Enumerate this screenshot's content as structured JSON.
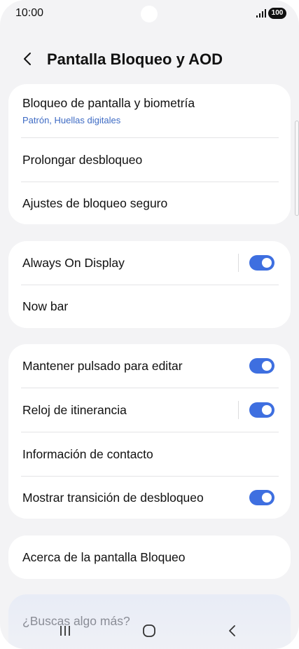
{
  "status_bar": {
    "time": "10:00",
    "battery": "100"
  },
  "header": {
    "title": "Pantalla Bloqueo y AOD"
  },
  "group1": {
    "lock_screen_label": "Bloqueo de pantalla y biometría",
    "lock_screen_sub": "Patrón, Huellas digitales",
    "extend_unlock_label": "Prolongar desbloqueo",
    "secure_lock_label": "Ajustes de bloqueo seguro"
  },
  "group2": {
    "aod_label": "Always On Display",
    "aod_enabled": true,
    "now_bar_label": "Now bar"
  },
  "group3": {
    "hold_edit_label": "Mantener pulsado para editar",
    "hold_edit_enabled": true,
    "roaming_clock_label": "Reloj de itinerancia",
    "roaming_clock_enabled": true,
    "contact_info_label": "Información de contacto",
    "unlock_transition_label": "Mostrar transición de desbloqueo",
    "unlock_transition_enabled": true
  },
  "group4": {
    "about_label": "Acerca de la pantalla Bloqueo"
  },
  "more": {
    "label": "¿Buscas algo más?"
  },
  "colors": {
    "accent": "#3e6fe0",
    "subtext": "#3e6bc4",
    "background": "#f3f3f5"
  },
  "icons": [
    "back-icon",
    "signal-icon",
    "recent-apps-icon",
    "home-icon",
    "nav-back-icon"
  ]
}
